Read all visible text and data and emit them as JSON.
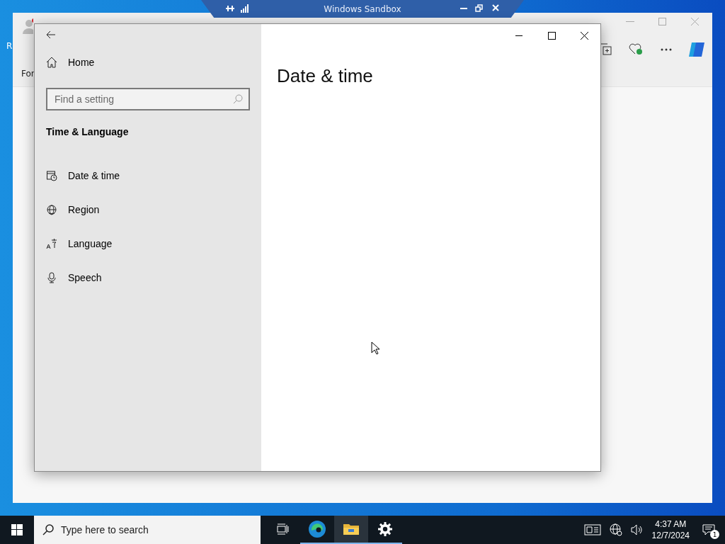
{
  "desktop": {
    "icon_label": "R"
  },
  "sandbox_bar": {
    "title": "Windows Sandbox"
  },
  "browser": {
    "favorite": "For"
  },
  "settings": {
    "home": "Home",
    "search": {
      "placeholder": "Find a setting"
    },
    "section": "Time & Language",
    "items": [
      {
        "kind": "datetime",
        "label": "Date & time"
      },
      {
        "kind": "region",
        "label": "Region"
      },
      {
        "kind": "language",
        "label": "Language"
      },
      {
        "kind": "speech",
        "label": "Speech"
      }
    ],
    "page_title": "Date & time"
  },
  "taskbar": {
    "search": {
      "placeholder": "Type here to search"
    },
    "apps": [
      {
        "kind": "taskview",
        "running": false,
        "active": false
      },
      {
        "kind": "edge",
        "running": true,
        "active": false
      },
      {
        "kind": "explorer",
        "running": true,
        "active": true
      },
      {
        "kind": "settings",
        "running": true,
        "active": false
      }
    ],
    "time": "4:37 AM",
    "date": "12/7/2024",
    "notification_count": "1"
  }
}
